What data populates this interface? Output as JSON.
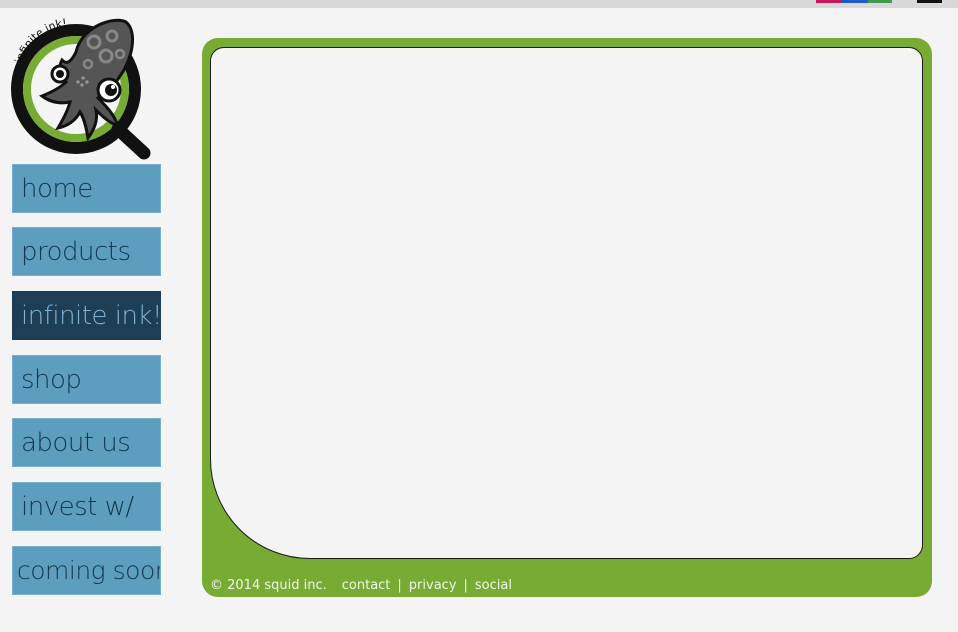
{
  "theme": {
    "nav_bg": "#5d9ebf",
    "nav_text": "#14384e",
    "nav_active_bg": "#1d3e54",
    "nav_active_text": "#7fb2d4",
    "panel_green": "#77ab33",
    "swatch_red": "#c2185b",
    "swatch_blue": "#1e5bc6",
    "swatch_green": "#3d9b4b",
    "swatch_black": "#111111"
  },
  "logo": {
    "text": "infinite ink!",
    "icon": "squid-magnifier-logo"
  },
  "nav": {
    "items": [
      {
        "label": "home",
        "active": false
      },
      {
        "label": "products",
        "active": false
      },
      {
        "label": "infinite ink!",
        "active": true
      },
      {
        "label": "shop",
        "active": false
      },
      {
        "label": "about us",
        "active": false
      },
      {
        "label": "invest w/",
        "active": false
      },
      {
        "label": "coming soon",
        "active": false
      }
    ]
  },
  "footer": {
    "copyright": "© 2014 squid inc.",
    "links": [
      "contact",
      "privacy",
      "social"
    ],
    "separator": "|"
  }
}
